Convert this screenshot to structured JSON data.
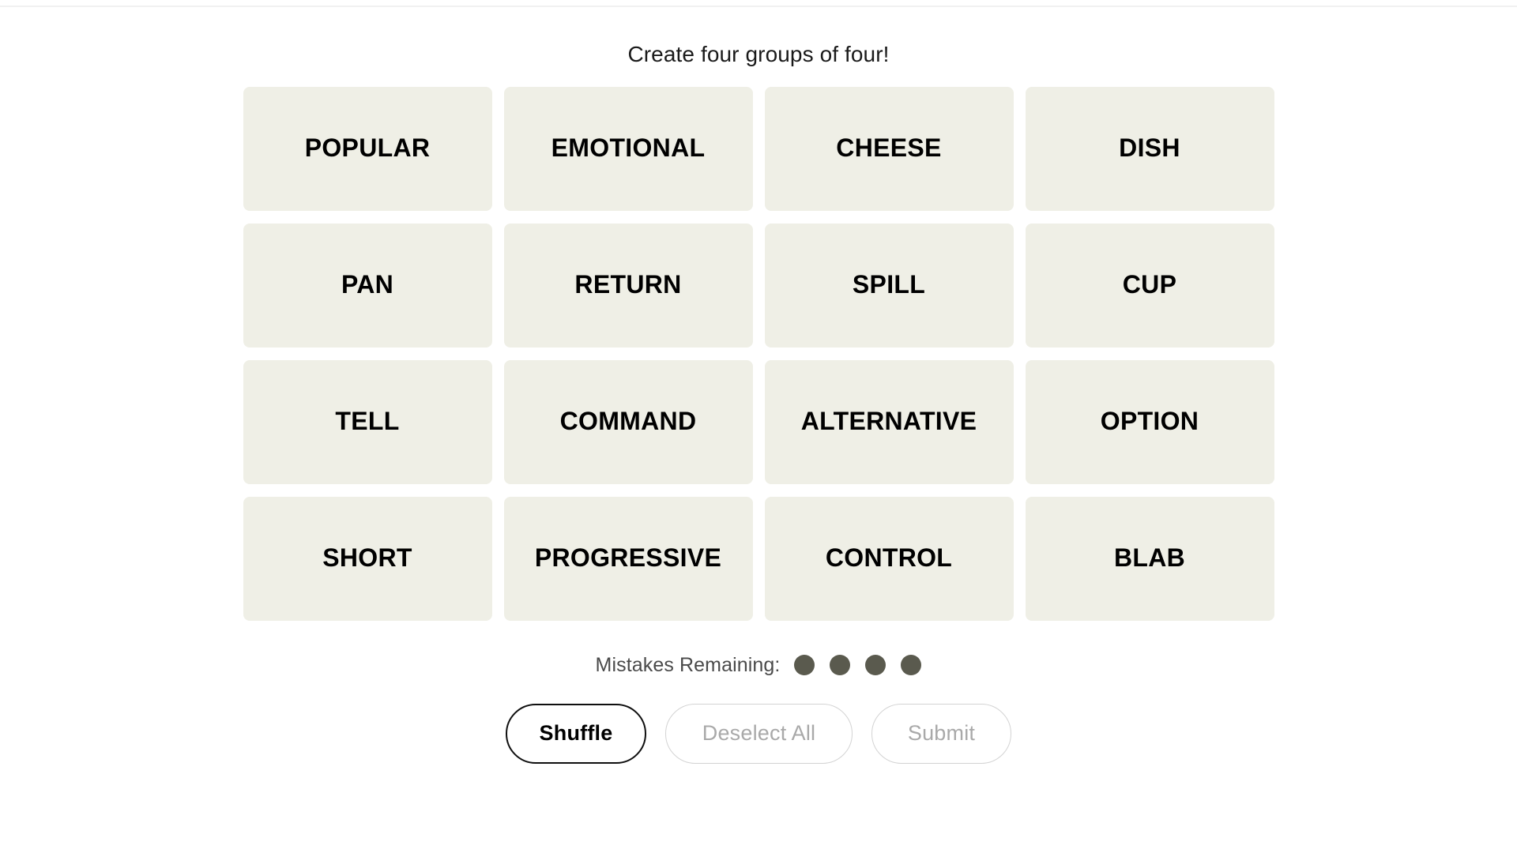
{
  "header": {
    "instruction": "Create four groups of four!"
  },
  "grid": {
    "rows": 4,
    "columns": 4,
    "tile_background_color": "#EFEFE6",
    "tiles": [
      {
        "label": "POPULAR",
        "selected": false
      },
      {
        "label": "EMOTIONAL",
        "selected": false
      },
      {
        "label": "CHEESE",
        "selected": false
      },
      {
        "label": "DISH",
        "selected": false
      },
      {
        "label": "PAN",
        "selected": false
      },
      {
        "label": "RETURN",
        "selected": false
      },
      {
        "label": "SPILL",
        "selected": false
      },
      {
        "label": "CUP",
        "selected": false
      },
      {
        "label": "TELL",
        "selected": false
      },
      {
        "label": "COMMAND",
        "selected": false
      },
      {
        "label": "ALTERNATIVE",
        "selected": false
      },
      {
        "label": "OPTION",
        "selected": false
      },
      {
        "label": "SHORT",
        "selected": false
      },
      {
        "label": "PROGRESSIVE",
        "selected": false
      },
      {
        "label": "CONTROL",
        "selected": false
      },
      {
        "label": "BLAB",
        "selected": false
      }
    ]
  },
  "mistakes": {
    "label": "Mistakes Remaining:",
    "remaining": 4,
    "dot_color": "#5A5A4E",
    "dots": [
      {
        "name": "mistake-dot-1",
        "filled": true
      },
      {
        "name": "mistake-dot-2",
        "filled": true
      },
      {
        "name": "mistake-dot-3",
        "filled": true
      },
      {
        "name": "mistake-dot-4",
        "filled": true
      }
    ]
  },
  "actions": {
    "shuffle": {
      "label": "Shuffle",
      "enabled": true
    },
    "deselect_all": {
      "label": "Deselect All",
      "enabled": false
    },
    "submit": {
      "label": "Submit",
      "enabled": false
    }
  },
  "theme": {
    "page_background": "#FFFFFF",
    "tile_text_color": "#000000",
    "muted_text_color": "#A9A9A9",
    "divider_color": "#F1F1F1"
  }
}
